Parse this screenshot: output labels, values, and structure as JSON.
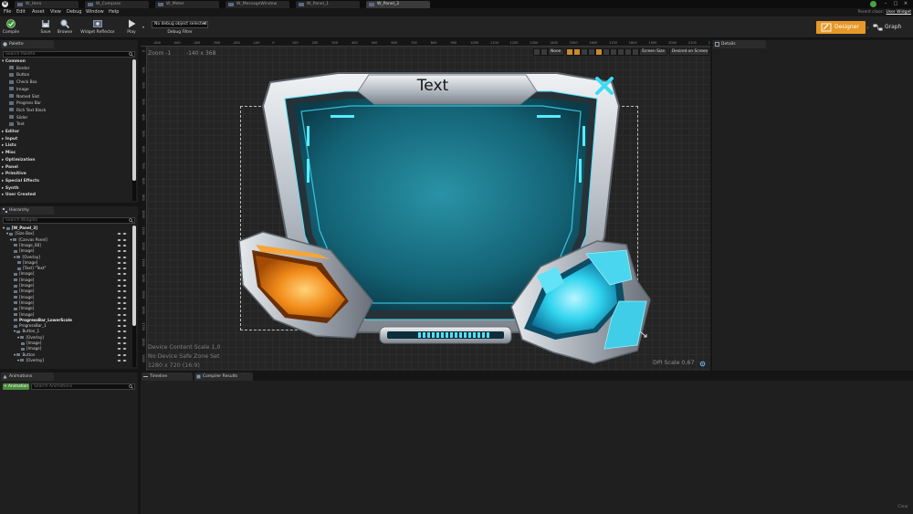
{
  "titlebar": {
    "tabs": [
      "W_Hero",
      "W_Compass",
      "W_Meter",
      "W_MessageWindow",
      "W_Panel_1",
      "W_Panel_3"
    ],
    "active_tab_index": 5,
    "window_controls": [
      "–",
      "□",
      "×"
    ]
  },
  "menubar": {
    "items": [
      "File",
      "Edit",
      "Asset",
      "View",
      "Debug",
      "Window",
      "Help"
    ],
    "parent_class_label": "Parent class:",
    "parent_class_value": "User Widget"
  },
  "toolbar": {
    "compile": "Compile",
    "save": "Save",
    "browse": "Browse",
    "widget_reflector": "Widget Reflector",
    "play": "Play",
    "debug_selector": "No debug object selected",
    "debug_filter": "Debug Filter",
    "designer": "Designer",
    "graph": "Graph"
  },
  "palette": {
    "tab": "Palette",
    "search_placeholder": "Search Palette",
    "common_category": "Common",
    "common_items": [
      "Border",
      "Button",
      "Check Box",
      "Image",
      "Named Slot",
      "Progress Bar",
      "Rich Text Block",
      "Slider",
      "Text"
    ],
    "categories": [
      "Editor",
      "Input",
      "Lists",
      "Misc",
      "Optimization",
      "Panel",
      "Primitive",
      "Special Effects",
      "Synth",
      "User Created"
    ]
  },
  "hierarchy": {
    "tab": "Hierarchy",
    "search_placeholder": "Search Widgets",
    "rows": [
      {
        "label": "[W_Panel_3]",
        "indent": 0,
        "bold": true,
        "arrow": "▾"
      },
      {
        "label": "[Size Box]",
        "indent": 1,
        "bold": false,
        "arrow": "▾"
      },
      {
        "label": "[Canvas Panel]",
        "indent": 2,
        "bold": false,
        "arrow": "▾"
      },
      {
        "label": "[Image_68]",
        "indent": 3,
        "bold": false,
        "arrow": ""
      },
      {
        "label": "[Image]",
        "indent": 3,
        "bold": false,
        "arrow": ""
      },
      {
        "label": "[Overlay]",
        "indent": 3,
        "bold": false,
        "arrow": "▾"
      },
      {
        "label": "[Image]",
        "indent": 4,
        "bold": false,
        "arrow": ""
      },
      {
        "label": "[Text] \"Text\"",
        "indent": 4,
        "bold": false,
        "arrow": ""
      },
      {
        "label": "[Image]",
        "indent": 3,
        "bold": false,
        "arrow": ""
      },
      {
        "label": "[Image]",
        "indent": 3,
        "bold": false,
        "arrow": ""
      },
      {
        "label": "[Image]",
        "indent": 3,
        "bold": false,
        "arrow": ""
      },
      {
        "label": "[Image]",
        "indent": 3,
        "bold": false,
        "arrow": ""
      },
      {
        "label": "[Image]",
        "indent": 3,
        "bold": false,
        "arrow": ""
      },
      {
        "label": "[Image]",
        "indent": 3,
        "bold": false,
        "arrow": ""
      },
      {
        "label": "[Image]",
        "indent": 3,
        "bold": false,
        "arrow": ""
      },
      {
        "label": "[Image]",
        "indent": 3,
        "bold": false,
        "arrow": ""
      },
      {
        "label": "ProgressBar_LowerScale",
        "indent": 3,
        "bold": true,
        "arrow": ""
      },
      {
        "label": "ProgressBar_1",
        "indent": 3,
        "bold": false,
        "arrow": ""
      },
      {
        "label": "Button_1",
        "indent": 3,
        "bold": false,
        "arrow": "▾"
      },
      {
        "label": "[Overlay]",
        "indent": 4,
        "bold": false,
        "arrow": "▾"
      },
      {
        "label": "[Image]",
        "indent": 5,
        "bold": false,
        "arrow": ""
      },
      {
        "label": "[Image]",
        "indent": 5,
        "bold": false,
        "arrow": ""
      },
      {
        "label": "Button",
        "indent": 3,
        "bold": false,
        "arrow": "▾"
      },
      {
        "label": "[Overlay]",
        "indent": 4,
        "bold": false,
        "arrow": "▾"
      }
    ]
  },
  "animations": {
    "tab": "Animations",
    "add_button": "+ Animation",
    "search_placeholder": "Search Animations"
  },
  "viewport": {
    "zoom": "Zoom -1",
    "size": "-140 x 368",
    "ruler_top": [
      "-600",
      "-500",
      "-400",
      "-300",
      "-200",
      "-100",
      "0",
      "100",
      "200",
      "300",
      "400",
      "500",
      "600",
      "700",
      "800",
      "900",
      "1000",
      "1100",
      "1200",
      "1300",
      "1400",
      "1500",
      "1600",
      "1700",
      "1800",
      "1900",
      "2000",
      "2100",
      "2200"
    ],
    "ruler_left": [
      "0",
      "100",
      "200",
      "300",
      "400",
      "500",
      "600",
      "700",
      "800",
      "900",
      "1000",
      "1100",
      "1200",
      "1300",
      "1400",
      "1500",
      "1600",
      "1700",
      "1800",
      "1900"
    ],
    "info_lines": [
      "Device Content Scale 1,0",
      "No Device Safe Zone Set",
      "1280 x 720 (16:9)"
    ],
    "dpi_scale": "DPI Scale 0,67",
    "none_label": "None",
    "screen_size": "Screen Size",
    "desired_on_screen": "Desired on Screen",
    "widget_text": "Text",
    "close_glyph": "X"
  },
  "details": {
    "tab": "Details"
  },
  "bottom": {
    "timeline_tab": "Timeline",
    "compiler_tab": "Compiler Results",
    "clear": "Clear"
  },
  "colors": {
    "accent_orange": "#e69828",
    "teal_glass": "#1b7f92",
    "cyan_glow": "#2fd4ee",
    "orange_gem": "#f28c1a"
  }
}
